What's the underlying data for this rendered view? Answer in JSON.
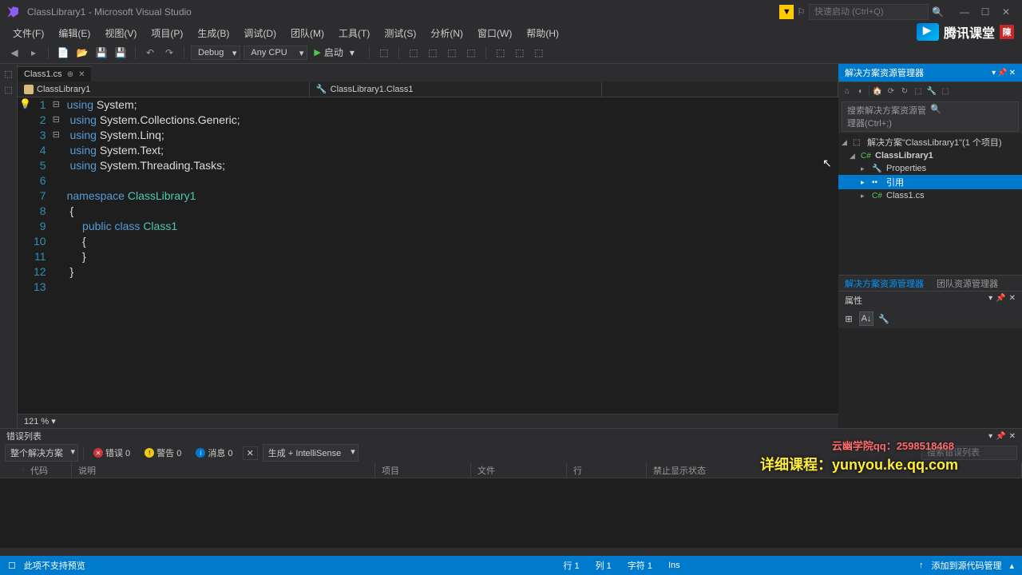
{
  "title": "ClassLibrary1 - Microsoft Visual Studio",
  "quickLaunch": "快速启动 (Ctrl+Q)",
  "menu": [
    "文件(F)",
    "编辑(E)",
    "视图(V)",
    "项目(P)",
    "生成(B)",
    "调试(D)",
    "团队(M)",
    "工具(T)",
    "测试(S)",
    "分析(N)",
    "窗口(W)",
    "帮助(H)"
  ],
  "brand": "腾讯课堂",
  "brandBadge": "陳",
  "config": "Debug",
  "platform": "Any CPU",
  "startLabel": "启动",
  "tab": {
    "name": "Class1.cs"
  },
  "nav": {
    "ns": "ClassLibrary1",
    "cls": "ClassLibrary1.Class1"
  },
  "code": {
    "lines": [
      1,
      2,
      3,
      4,
      5,
      6,
      7,
      8,
      9,
      10,
      11,
      12,
      13
    ],
    "fold": [
      "⊟",
      " ",
      " ",
      " ",
      " ",
      " ",
      "⊟",
      " ",
      "⊟",
      " ",
      " ",
      " ",
      " "
    ],
    "text": [
      "<span class='kw'>using</span> System;",
      " <span class='kw'>using</span> System.Collections.Generic;",
      " <span class='kw'>using</span> System.Linq;",
      " <span class='kw'>using</span> System.Text;",
      " <span class='kw'>using</span> System.Threading.Tasks;",
      "",
      "<span class='kw'>namespace</span> <span class='type'>ClassLibrary1</span>",
      " {",
      "     <span class='kw'>public</span> <span class='kw'>class</span> <span class='type'>Class1</span>",
      "     {",
      "     }",
      " }",
      ""
    ]
  },
  "zoom": "121 %",
  "solutionExplorer": {
    "title": "解决方案资源管理器",
    "search": "搜索解决方案资源管理器(Ctrl+;)",
    "root": "解决方案\"ClassLibrary1\"(1 个项目)",
    "project": "ClassLibrary1",
    "nodes": {
      "properties": "Properties",
      "references": "引用",
      "file": "Class1.cs"
    },
    "tabs": [
      "解决方案资源管理器",
      "团队资源管理器"
    ]
  },
  "properties": {
    "title": "属性"
  },
  "errorList": {
    "title": "错误列表",
    "scope": "整个解决方案",
    "errors": "错误 0",
    "warnings": "警告 0",
    "messages": "消息 0",
    "build": "生成 + IntelliSense",
    "search": "搜索错误列表",
    "cols": [
      "",
      "代码",
      "说明",
      "项目",
      "文件",
      "行",
      "禁止显示状态"
    ]
  },
  "status": {
    "preview": "此项不支持预览",
    "line": "行 1",
    "col": "列 1",
    "char": "字符 1",
    "ins": "Ins",
    "scm": "添加到源代码管理"
  },
  "watermark": {
    "qq": "云幽学院qq：2598518468",
    "course": "详细课程：yunyou.ke.qq.com"
  }
}
